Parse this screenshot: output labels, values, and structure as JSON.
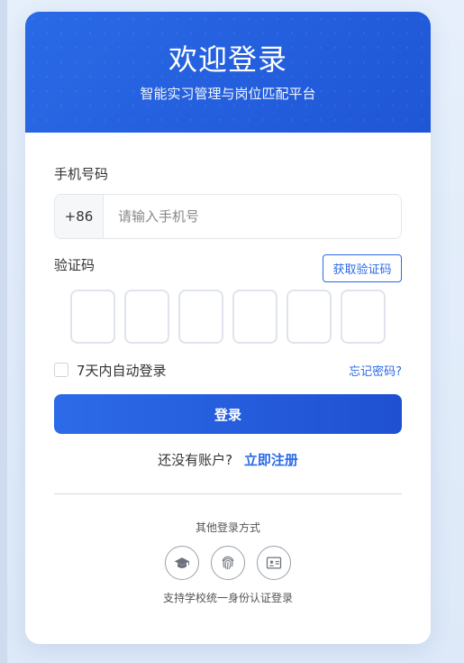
{
  "header": {
    "title": "欢迎登录",
    "subtitle": "智能实习管理与岗位匹配平台"
  },
  "phone": {
    "label": "手机号码",
    "prefix": "+86",
    "placeholder": "请输入手机号",
    "value": ""
  },
  "code": {
    "label": "验证码",
    "get_code_label": "获取验证码",
    "digits": [
      "",
      "",
      "",
      "",
      "",
      ""
    ]
  },
  "options": {
    "remember_label": "7天内自动登录",
    "remember_checked": false,
    "forgot_label": "忘记密码?"
  },
  "login_button": "登录",
  "register": {
    "question": "还没有账户?",
    "link": "立即注册"
  },
  "other_login": {
    "title": "其他登录方式",
    "icons": [
      "graduation-cap-icon",
      "fingerprint-icon",
      "id-card-icon"
    ],
    "tip": "支持学校统一身份认证登录"
  },
  "colors": {
    "primary": "#2a6ae6",
    "primary_dark": "#1f50d2",
    "background": "#e6effb"
  }
}
